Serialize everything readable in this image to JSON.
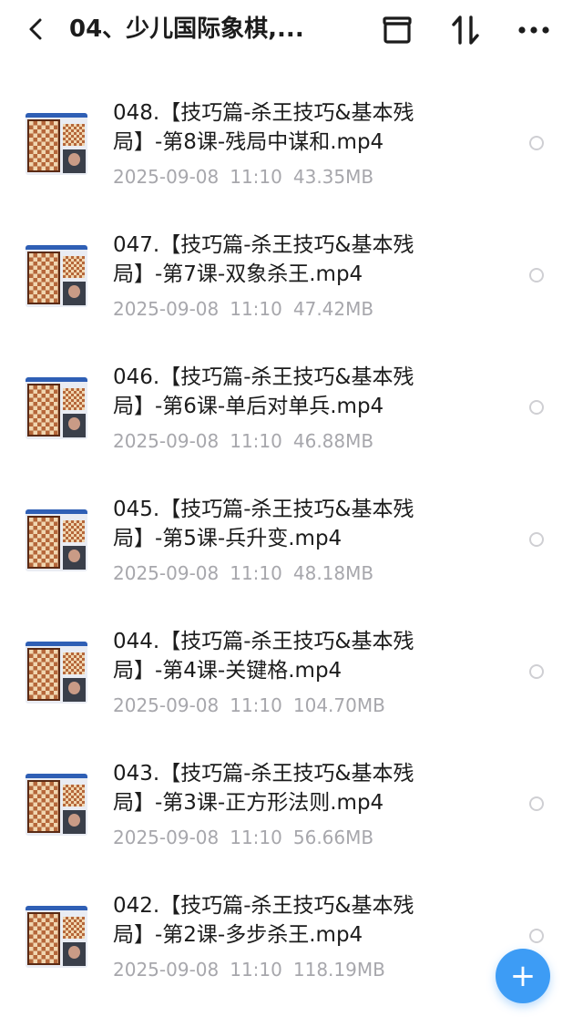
{
  "header": {
    "title": "04、少儿国际象棋,...",
    "icons": {
      "back": "chevron-left-icon",
      "archive": "archive-box-icon",
      "sort": "sort-arrows-icon",
      "more": "more-dots-icon"
    }
  },
  "files": [
    {
      "name": "048.【技巧篇-杀王技巧&基本残局】-第8课-残局中谋和.mp4",
      "date": "2025-09-08",
      "time": "11:10",
      "size": "43.35MB"
    },
    {
      "name": "047.【技巧篇-杀王技巧&基本残局】-第7课-双象杀王.mp4",
      "date": "2025-09-08",
      "time": "11:10",
      "size": "47.42MB"
    },
    {
      "name": "046.【技巧篇-杀王技巧&基本残局】-第6课-单后对单兵.mp4",
      "date": "2025-09-08",
      "time": "11:10",
      "size": "46.88MB"
    },
    {
      "name": "045.【技巧篇-杀王技巧&基本残局】-第5课-兵升变.mp4",
      "date": "2025-09-08",
      "time": "11:10",
      "size": "48.18MB"
    },
    {
      "name": "044.【技巧篇-杀王技巧&基本残局】-第4课-关键格.mp4",
      "date": "2025-09-08",
      "time": "11:10",
      "size": "104.70MB"
    },
    {
      "name": "043.【技巧篇-杀王技巧&基本残局】-第3课-正方形法则.mp4",
      "date": "2025-09-08",
      "time": "11:10",
      "size": "56.66MB"
    },
    {
      "name": "042.【技巧篇-杀王技巧&基本残局】-第2课-多步杀王.mp4",
      "date": "2025-09-08",
      "time": "11:10",
      "size": "118.19MB"
    }
  ],
  "fab": {
    "label": "+",
    "icon": "plus-icon",
    "color": "#3d9cf5"
  }
}
